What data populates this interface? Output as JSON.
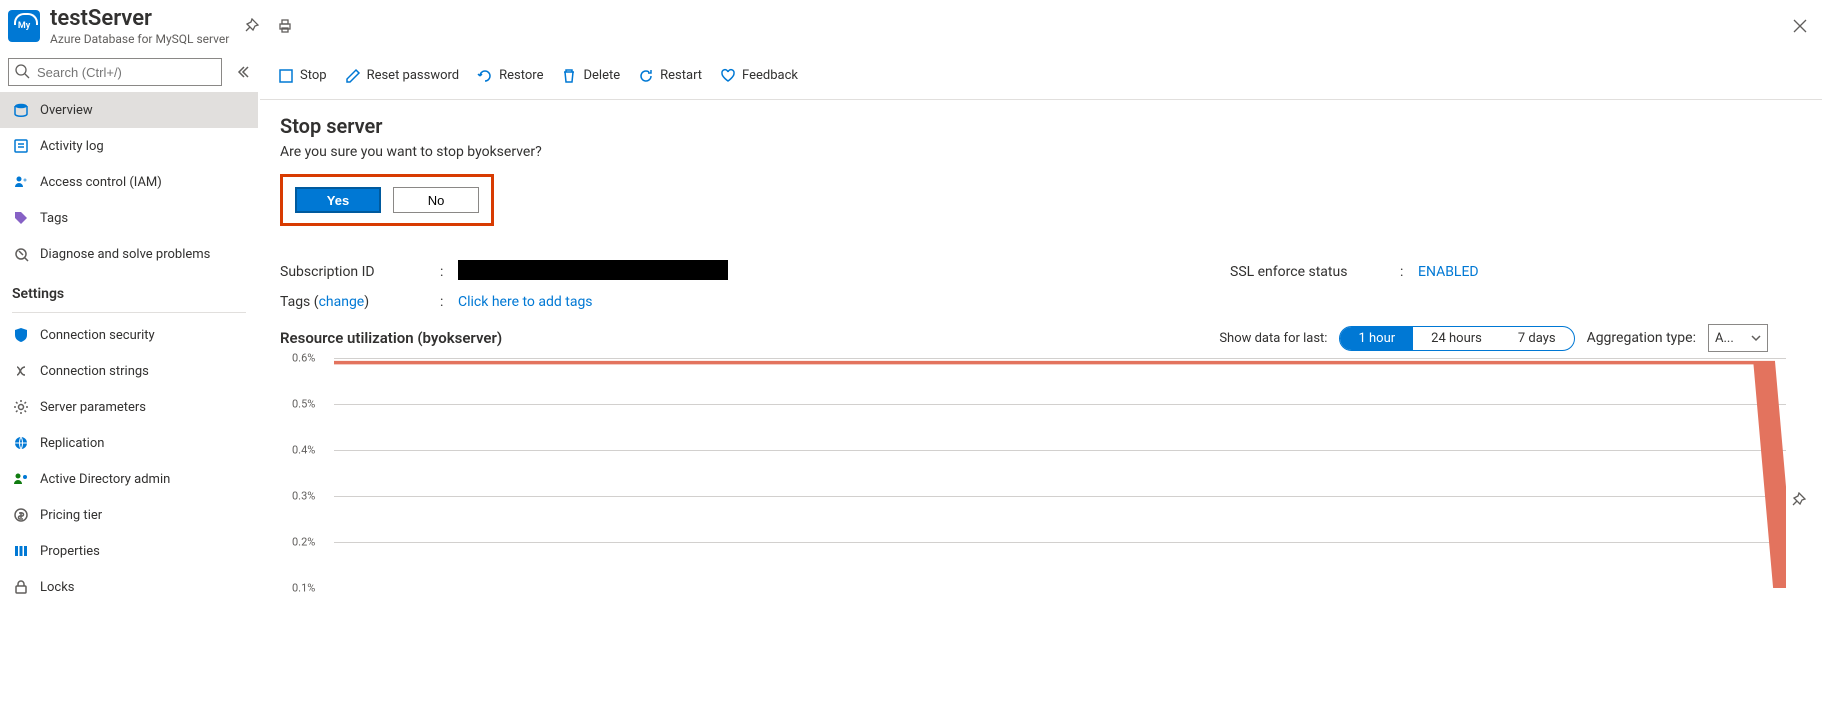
{
  "header": {
    "title": "testServer",
    "subtitle": "Azure Database for MySQL server"
  },
  "nav": {
    "search_placeholder": "Search (Ctrl+/)",
    "items": [
      {
        "label": "Overview"
      },
      {
        "label": "Activity log"
      },
      {
        "label": "Access control (IAM)"
      },
      {
        "label": "Tags"
      },
      {
        "label": "Diagnose and solve problems"
      }
    ],
    "settings_header": "Settings",
    "settings": [
      {
        "label": "Connection security"
      },
      {
        "label": "Connection strings"
      },
      {
        "label": "Server parameters"
      },
      {
        "label": "Replication"
      },
      {
        "label": "Active Directory admin"
      },
      {
        "label": "Pricing tier"
      },
      {
        "label": "Properties"
      },
      {
        "label": "Locks"
      }
    ]
  },
  "toolbar": {
    "stop": "Stop",
    "reset": "Reset password",
    "restore": "Restore",
    "delete": "Delete",
    "restart": "Restart",
    "feedback": "Feedback"
  },
  "dialog": {
    "title": "Stop server",
    "text": "Are you sure you want to stop byokserver?",
    "yes": "Yes",
    "no": "No"
  },
  "props": {
    "sub_id_label": "Subscription ID",
    "tags_label": "Tags (",
    "tags_change": "change",
    "tags_close": ")",
    "tags_add": "Click here to add tags",
    "ssl_label": "SSL enforce status",
    "ssl_value": "ENABLED"
  },
  "utilization": {
    "show_label": "Show data for last:",
    "range": [
      "1 hour",
      "24 hours",
      "7 days"
    ],
    "agg_label": "Aggregation type:",
    "agg_value": "A...",
    "title": "Resource utilization (byokserver)"
  },
  "chart_data": {
    "type": "line",
    "ylabel": "%",
    "ylim": [
      0.1,
      0.6
    ],
    "yticks": [
      "0.6%",
      "0.5%",
      "0.4%",
      "0.3%",
      "0.2%",
      "0.1%"
    ],
    "series": [
      {
        "name": "utilization",
        "x": [
          0,
          0.97,
          0.985,
          1
        ],
        "y": [
          0.59,
          0.59,
          0.59,
          0.05
        ]
      }
    ]
  }
}
